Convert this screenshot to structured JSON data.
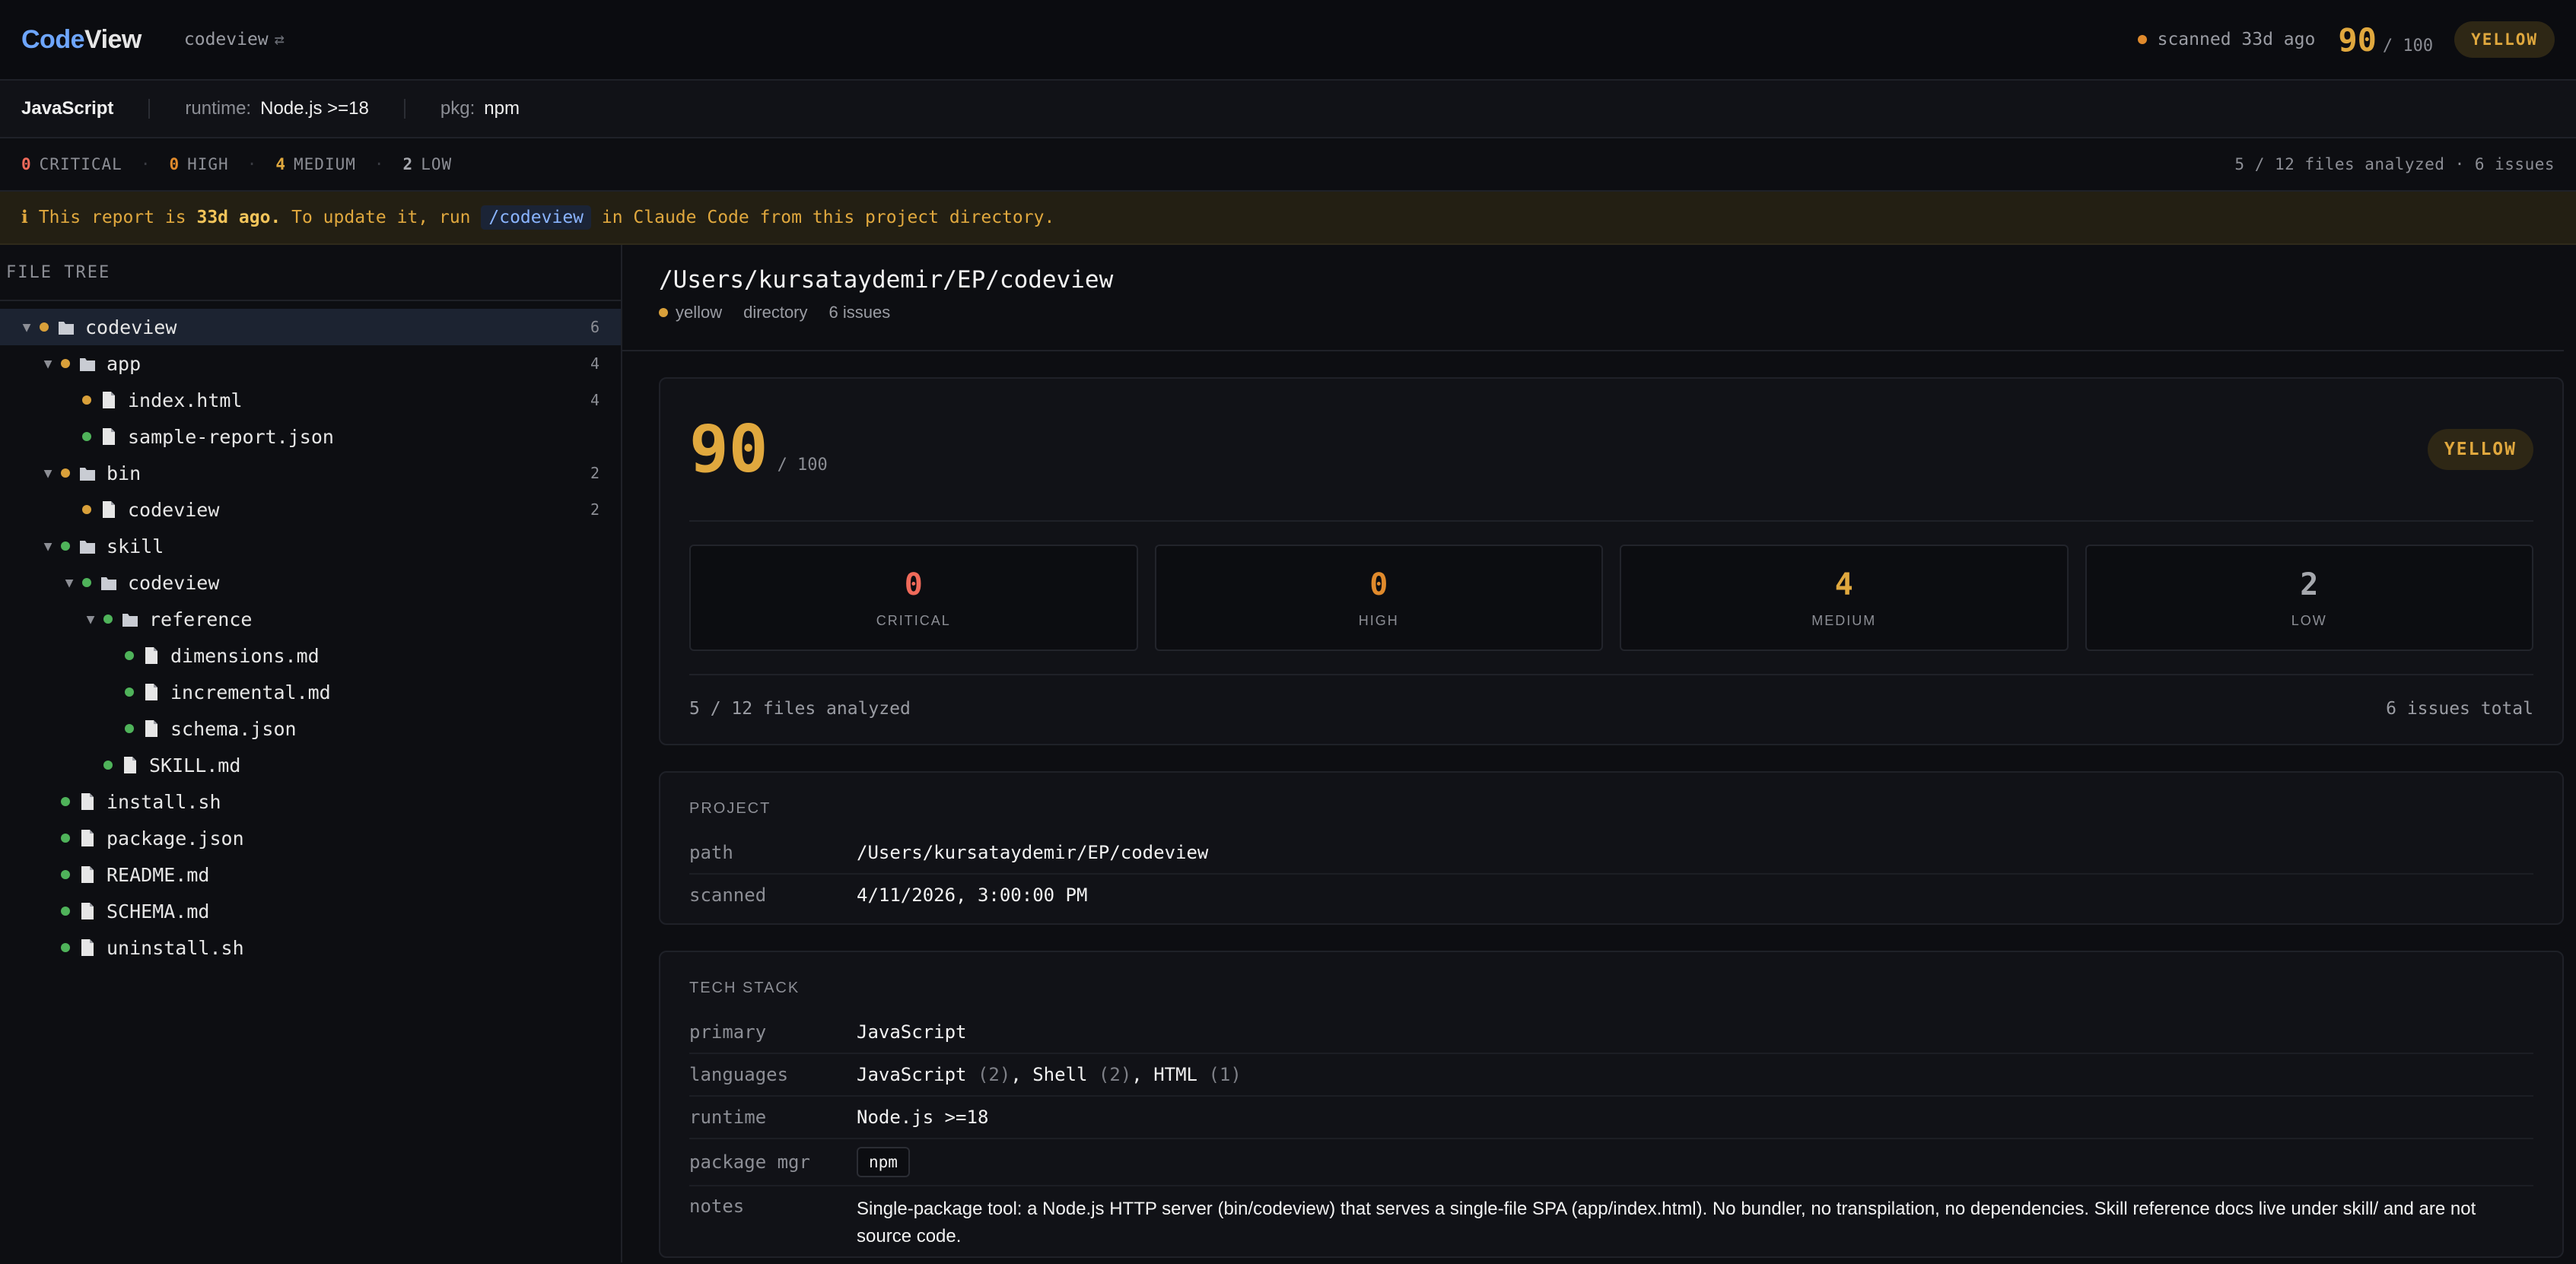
{
  "app": {
    "logo_part1": "Code",
    "logo_part2": "View",
    "project": "codeview",
    "swap_glyph": "⇄"
  },
  "top": {
    "scanned": "scanned 33d ago",
    "score": "90",
    "score_den": "/ 100",
    "status": "YELLOW"
  },
  "meta": {
    "language": "JavaScript",
    "runtime_key": "runtime:",
    "runtime_val": "Node.js >=18",
    "pkg_key": "pkg:",
    "pkg_val": "npm"
  },
  "severity": {
    "critical": {
      "n": "0",
      "label": "CRITICAL"
    },
    "high": {
      "n": "0",
      "label": "HIGH"
    },
    "medium": {
      "n": "4",
      "label": "MEDIUM"
    },
    "low": {
      "n": "2",
      "label": "LOW"
    },
    "summary": "5 / 12 files analyzed · 6 issues"
  },
  "notice": {
    "icon": "ℹ",
    "pre": "This report is",
    "age": "33d ago.",
    "mid": "To update it, run",
    "cmd": "/codeview",
    "post": "in Claude Code from this project directory."
  },
  "sidebar": {
    "title": "FILE TREE",
    "rows": [
      {
        "name": "codeview",
        "count": "6"
      },
      {
        "name": "app",
        "count": "4"
      },
      {
        "name": "index.html",
        "count": "4"
      },
      {
        "name": "sample-report.json",
        "count": ""
      },
      {
        "name": "bin",
        "count": "2"
      },
      {
        "name": "codeview",
        "count": "2"
      },
      {
        "name": "skill",
        "count": ""
      },
      {
        "name": "codeview",
        "count": ""
      },
      {
        "name": "reference",
        "count": ""
      },
      {
        "name": "dimensions.md",
        "count": ""
      },
      {
        "name": "incremental.md",
        "count": ""
      },
      {
        "name": "schema.json",
        "count": ""
      },
      {
        "name": "SKILL.md",
        "count": ""
      },
      {
        "name": "install.sh",
        "count": ""
      },
      {
        "name": "package.json",
        "count": ""
      },
      {
        "name": "README.md",
        "count": ""
      },
      {
        "name": "SCHEMA.md",
        "count": ""
      },
      {
        "name": "uninstall.sh",
        "count": ""
      }
    ]
  },
  "detail": {
    "path": "/Users/kursataydemir/EP/codeview",
    "status": "yellow",
    "kind": "directory",
    "issues": "6 issues",
    "score": "90",
    "score_den": "/ 100",
    "badge": "YELLOW",
    "tiles": [
      {
        "n": "0",
        "label": "CRITICAL"
      },
      {
        "n": "0",
        "label": "HIGH"
      },
      {
        "n": "4",
        "label": "MEDIUM"
      },
      {
        "n": "2",
        "label": "LOW"
      }
    ],
    "files_analyzed": "5 / 12 files analyzed",
    "issues_total": "6 issues total"
  },
  "project": {
    "title": "PROJECT",
    "path_key": "path",
    "path_val": "/Users/kursataydemir/EP/codeview",
    "scanned_key": "scanned",
    "scanned_val": "4/11/2026, 3:00:00 PM"
  },
  "tech": {
    "title": "TECH STACK",
    "primary_key": "primary",
    "primary_val": "JavaScript",
    "languages_key": "languages",
    "lang1": "JavaScript",
    "lang1_n": "(2)",
    "lang2": "Shell",
    "lang2_n": "(2)",
    "lang3": "HTML",
    "lang3_n": "(1)",
    "runtime_key": "runtime",
    "runtime_val": "Node.js >=18",
    "pkg_key": "package mgr",
    "pkg_val": "npm",
    "notes_key": "notes",
    "notes_val": "Single-package tool: a Node.js HTTP server (bin/codeview) that serves a single-file SPA (app/index.html). No bundler, no transpilation, no dependencies. Skill reference docs live under skill/ and are not source code."
  }
}
